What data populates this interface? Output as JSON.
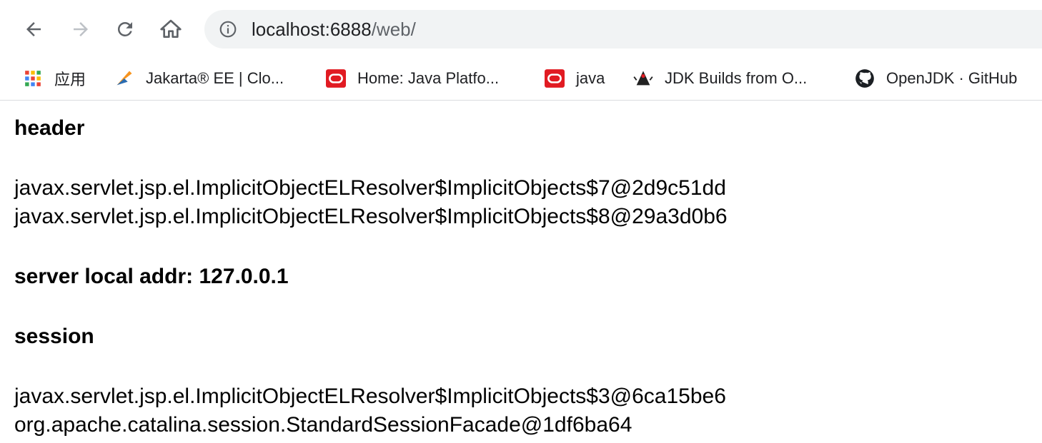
{
  "browser": {
    "url_host": "localhost:6888",
    "url_path": "/web/",
    "bookmarks": [
      {
        "label": "应用",
        "icon": "apps-grid-icon"
      },
      {
        "label": "Jakarta® EE | Clo...",
        "icon": "jakarta-logo-icon"
      },
      {
        "label": "Home: Java Platfo...",
        "icon": "oracle-logo-icon"
      },
      {
        "label": "java",
        "icon": "oracle-logo-icon"
      },
      {
        "label": "JDK Builds from O...",
        "icon": "duke-icon"
      },
      {
        "label": "OpenJDK · GitHub",
        "icon": "github-icon"
      }
    ]
  },
  "page": {
    "header_title": "header",
    "header_lines": [
      "javax.servlet.jsp.el.ImplicitObjectELResolver$ImplicitObjects$7@2d9c51dd",
      "javax.servlet.jsp.el.ImplicitObjectELResolver$ImplicitObjects$8@29a3d0b6"
    ],
    "server_addr": "server local addr: 127.0.0.1",
    "session_title": "session",
    "session_lines": [
      "javax.servlet.jsp.el.ImplicitObjectELResolver$ImplicitObjects$3@6ca15be6",
      "org.apache.catalina.session.StandardSessionFacade@1df6ba64"
    ]
  },
  "colors": {
    "toolbar_bg": "#ffffff",
    "omnibox_bg": "#f1f3f4",
    "oracle_red": "#e11b22",
    "icon_gray": "#5f6368"
  }
}
